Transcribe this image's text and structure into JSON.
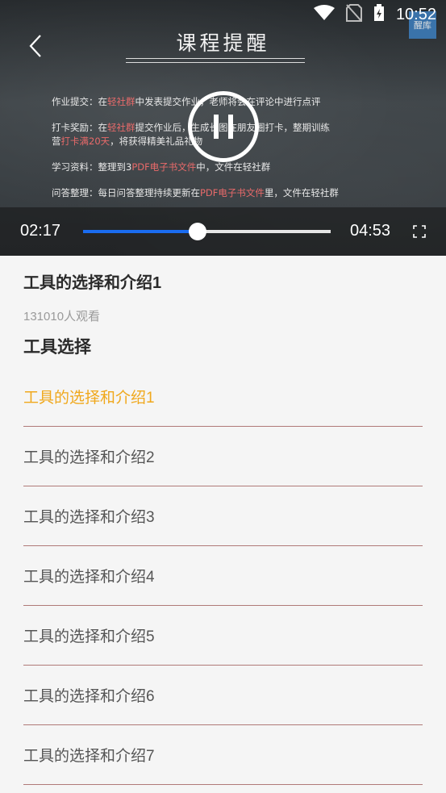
{
  "status_bar": {
    "time": "10:52"
  },
  "brand_badge": "醒库",
  "video": {
    "board_title": "课程提醒",
    "board_lines": [
      {
        "parts": [
          {
            "t": "作业提交：在",
            "h": false
          },
          {
            "t": "轻社群",
            "h": true
          },
          {
            "t": "中发表提交作业，老师将会在评论中进行点评",
            "h": false
          }
        ]
      },
      {
        "parts": [
          {
            "t": "打卡奖励：在",
            "h": false
          },
          {
            "t": "轻社群",
            "h": true
          },
          {
            "t": "提交作业后，生成长图在朋友圈打卡，整期训练",
            "h": false
          }
        ]
      },
      {
        "parts": [
          {
            "t": "营",
            "h": false
          },
          {
            "t": "打卡满20天",
            "h": true
          },
          {
            "t": "，将获得精美礼品礼物",
            "h": false
          }
        ]
      },
      {
        "parts": [
          {
            "t": "学习资料：整理到3",
            "h": false
          },
          {
            "t": "PDF电子书文件",
            "h": true
          },
          {
            "t": "中，文件在轻社群",
            "h": false
          }
        ]
      },
      {
        "parts": [
          {
            "t": "问答整理：每日问答整理持续更新在",
            "h": false
          },
          {
            "t": "PDF电子书文件",
            "h": true
          },
          {
            "t": "里，文件在轻社群",
            "h": false
          }
        ]
      }
    ],
    "current_time": "02:17",
    "total_time": "04:53",
    "progress": 0.462,
    "accent_color": "#1a6cf0"
  },
  "course": {
    "title": "工具的选择和介绍1",
    "views": "131010人观看",
    "section_title": "工具选择",
    "lessons": [
      {
        "label": "工具的选择和介绍1",
        "active": true
      },
      {
        "label": "工具的选择和介绍2",
        "active": false
      },
      {
        "label": "工具的选择和介绍3",
        "active": false
      },
      {
        "label": "工具的选择和介绍4",
        "active": false
      },
      {
        "label": "工具的选择和介绍5",
        "active": false
      },
      {
        "label": "工具的选择和介绍6",
        "active": false
      },
      {
        "label": "工具的选择和介绍7",
        "active": false
      }
    ],
    "active_color": "#f0a81c"
  }
}
